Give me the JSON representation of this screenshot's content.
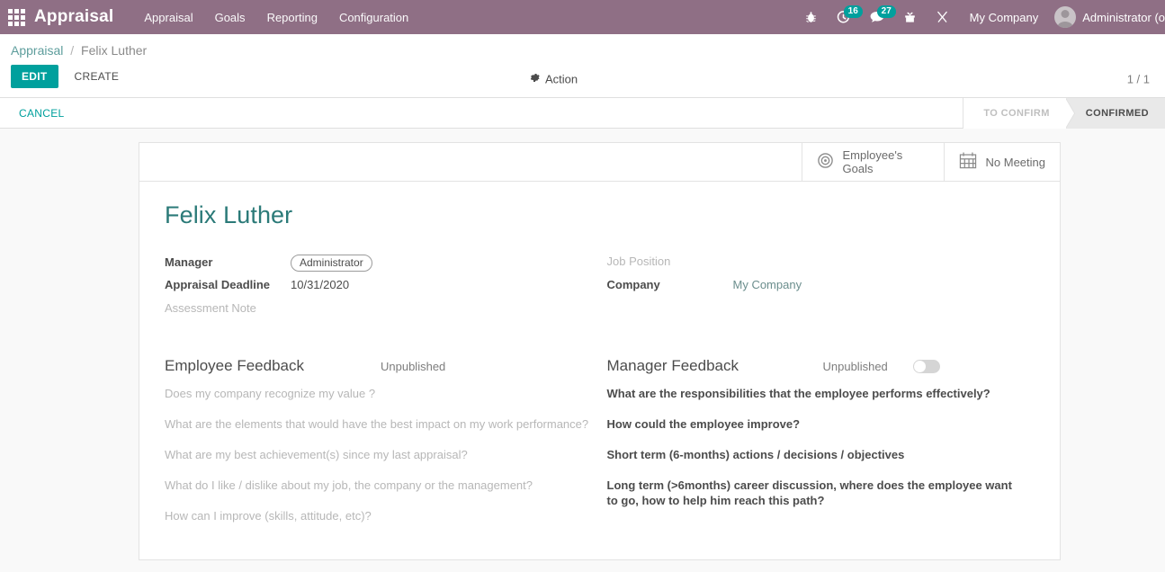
{
  "navbar": {
    "apps_icon": "apps-grid-icon",
    "brand": "Appraisal",
    "menu": [
      {
        "label": "Appraisal"
      },
      {
        "label": "Goals"
      },
      {
        "label": "Reporting"
      },
      {
        "label": "Configuration"
      }
    ],
    "systray": {
      "debug_icon": "bug-icon",
      "activity_icon": "clock-activity-icon",
      "activity_count": "16",
      "messaging_icon": "chat-bubble-icon",
      "messaging_count": "27",
      "gift_icon": "gift-icon",
      "shortcut_icon": "scissors-icon",
      "company": "My Company",
      "avatar": "user-avatar",
      "user": "Administrator (o"
    }
  },
  "control_panel": {
    "breadcrumb": {
      "root": "Appraisal",
      "separator": "/",
      "current": "Felix Luther"
    },
    "edit_label": "EDIT",
    "create_label": "CREATE",
    "action_icon": "gear-icon",
    "action_label": "Action",
    "pager": "1 / 1"
  },
  "statusbar": {
    "cancel_label": "CANCEL",
    "stages": [
      {
        "label": "TO CONFIRM",
        "active": false
      },
      {
        "label": "CONFIRMED",
        "active": true
      }
    ]
  },
  "sheet": {
    "stat_buttons": [
      {
        "icon": "target-icon",
        "label": "Employee's Goals"
      },
      {
        "icon": "calendar-icon",
        "label": "No Meeting"
      }
    ],
    "record_title": "Felix Luther",
    "fields_left": [
      {
        "label": "Manager",
        "value": "Administrator",
        "type": "tag",
        "empty": false
      },
      {
        "label": "Appraisal Deadline",
        "value": "10/31/2020",
        "type": "text",
        "empty": false
      },
      {
        "label": "Assessment Note",
        "value": "",
        "type": "text",
        "empty": true
      }
    ],
    "fields_right": [
      {
        "label": "Job Position",
        "value": "",
        "type": "text",
        "empty": true
      },
      {
        "label": "Company",
        "value": "My Company",
        "type": "link",
        "empty": false
      }
    ],
    "employee_feedback": {
      "title": "Employee Feedback",
      "state": "Unpublished",
      "questions": [
        "Does my company recognize my value ?",
        "What are the elements that would have the best impact on my work performance?",
        "What are my best achievement(s) since my last appraisal?",
        "What do I like / dislike about my job, the company or the management?",
        "How can I improve (skills, attitude, etc)?"
      ]
    },
    "manager_feedback": {
      "title": "Manager Feedback",
      "state": "Unpublished",
      "toggle_on": false,
      "questions": [
        "What are the responsibilities that the employee performs effectively?",
        "How could the employee improve?",
        "Short term (6-months) actions / decisions / objectives",
        "Long term (>6months) career discussion, where does the employee want to go, how to help him reach this path?"
      ]
    }
  },
  "colors": {
    "navbar": "#8f6f85",
    "accent_teal": "#00A09D",
    "title_teal": "#2b7a78",
    "badge": "#00A09D"
  }
}
